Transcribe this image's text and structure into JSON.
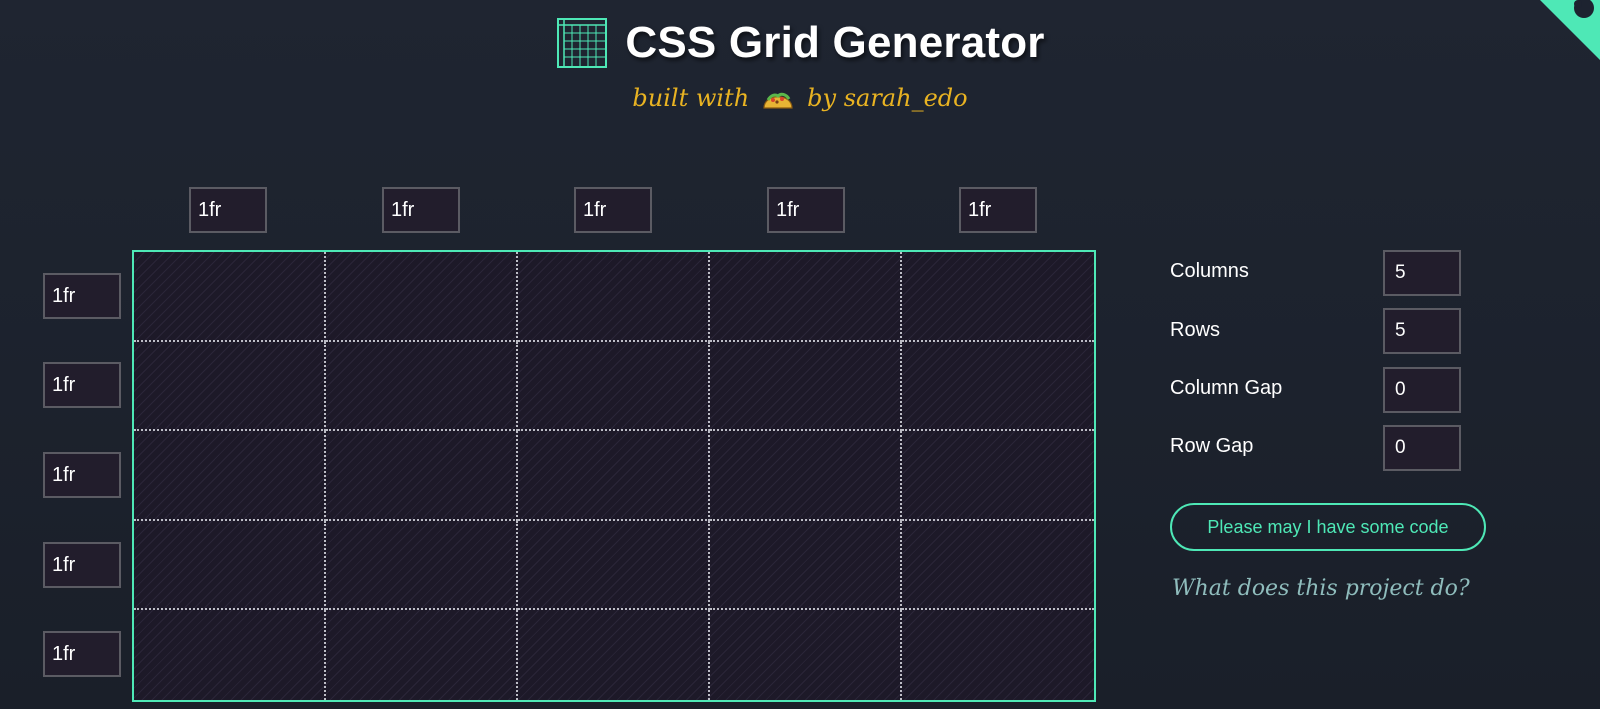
{
  "header": {
    "title": "CSS Grid Generator",
    "subtitle_prefix": "built with",
    "subtitle_suffix": "by sarah_edo",
    "title_icon": "grid-icon",
    "subtitle_icon": "taco-icon"
  },
  "column_tracks": [
    "1fr",
    "1fr",
    "1fr",
    "1fr",
    "1fr"
  ],
  "row_tracks": [
    "1fr",
    "1fr",
    "1fr",
    "1fr",
    "1fr"
  ],
  "settings": {
    "columns_label": "Columns",
    "columns_value": "5",
    "rows_label": "Rows",
    "rows_value": "5",
    "column_gap_label": "Column Gap",
    "column_gap_value": "0",
    "row_gap_label": "Row Gap",
    "row_gap_value": "0"
  },
  "actions": {
    "code_button_label": "Please may I have some code",
    "about_link_label": "What does this project do?"
  },
  "colors": {
    "background": "#1d2330",
    "accent": "#4ee8b6",
    "subtitle": "#e9b322",
    "input_bg": "#221d2c",
    "input_border": "#5b5b63",
    "link": "#8fbcbc"
  }
}
